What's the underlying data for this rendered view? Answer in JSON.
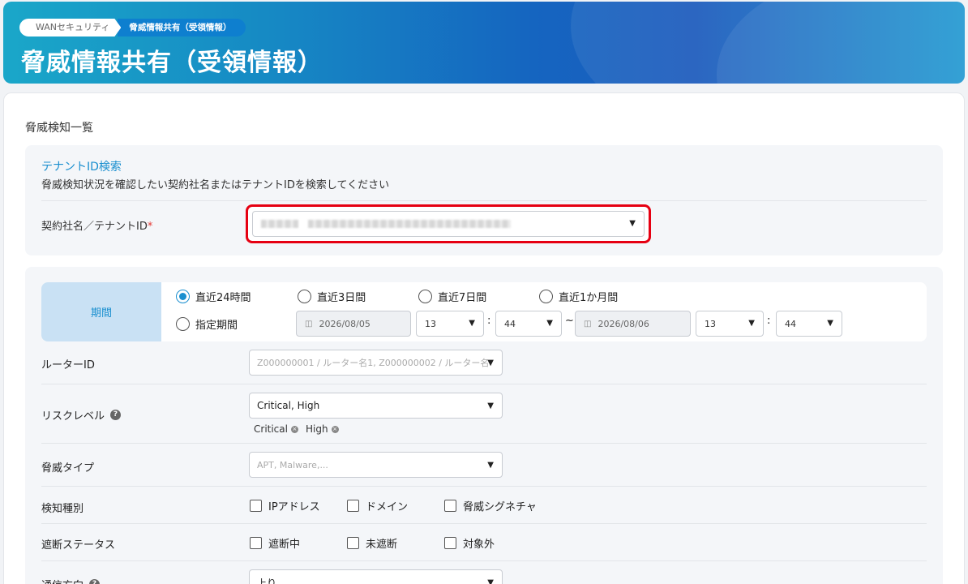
{
  "header": {
    "breadcrumb": [
      "WANセキュリティ",
      "脅威情報共有（受領情報）"
    ],
    "title": "脅威情報共有（受領情報）"
  },
  "main": {
    "section_title": "脅威検知一覧",
    "tenant": {
      "heading": "テナントID検索",
      "description": "脅威検知状況を確認したい契約社名またはテナントIDを検索してください",
      "label": "契約社名／テナントID",
      "required_mark": "*",
      "caret": "▼"
    },
    "period": {
      "label": "期間",
      "options": [
        "直近24時間",
        "直近3日間",
        "直近7日間",
        "直近1か月間",
        "指定期間"
      ],
      "selected": "直近24時間",
      "start_date": "2026/08/05",
      "start_hour": "13",
      "start_minute": "44",
      "tilde": "~",
      "colon": ":",
      "end_date": "2026/08/06",
      "end_hour": "13",
      "end_minute": "44"
    },
    "router": {
      "label": "ルーターID",
      "placeholder": "Z000000001 / ルーター名1, Z000000002 / ルーター名"
    },
    "risk": {
      "label": "リスクレベル",
      "help": "?",
      "value": "Critical, High",
      "chips": [
        "Critical",
        "High"
      ]
    },
    "threat_type": {
      "label": "脅威タイプ",
      "placeholder": "APT, Malware,..."
    },
    "detect_kind": {
      "label": "検知種別",
      "options": [
        "IPアドレス",
        "ドメイン",
        "脅威シグネチャ"
      ]
    },
    "block_status": {
      "label": "遮断ステータス",
      "options": [
        "遮断中",
        "未遮断",
        "対象外"
      ]
    },
    "direction": {
      "label": "通信方向",
      "help": "?",
      "value": "上り"
    }
  }
}
